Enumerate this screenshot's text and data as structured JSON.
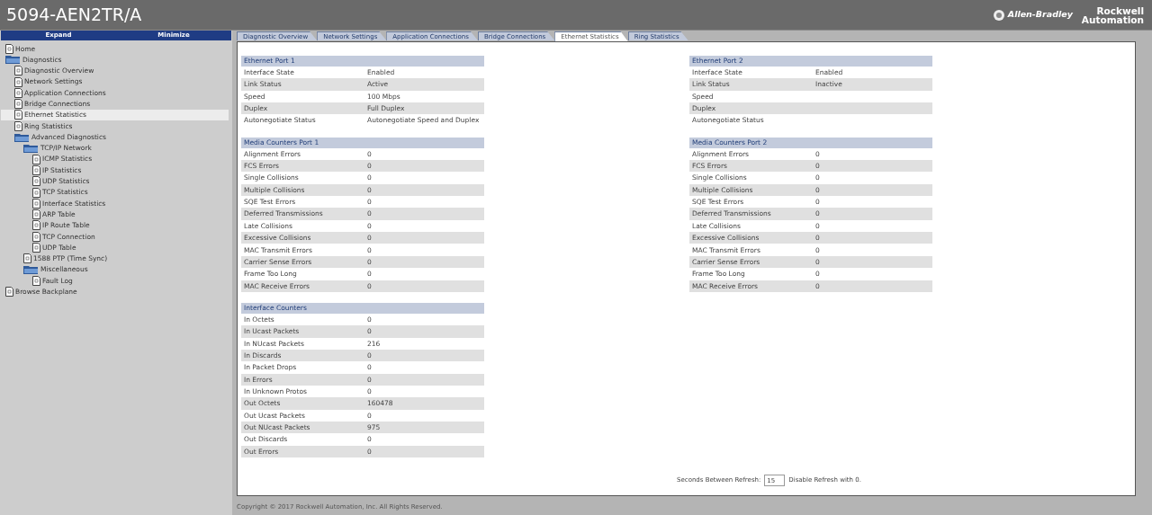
{
  "header": {
    "title": "5094-AEN2TR/A",
    "brand_1": "Allen-Bradley",
    "brand_2_line_1": "Rockwell",
    "brand_2_line_2": "Automation"
  },
  "sidebar": {
    "buttons": [
      "Expand",
      "Minimize"
    ],
    "items": [
      {
        "label": "Home",
        "kind": "page",
        "selected": false
      },
      {
        "label": "Diagnostics",
        "kind": "folder",
        "selected": false,
        "children": [
          {
            "label": "Diagnostic Overview",
            "kind": "page",
            "selected": false
          },
          {
            "label": "Network Settings",
            "kind": "page",
            "selected": false
          },
          {
            "label": "Application Connections",
            "kind": "page",
            "selected": false
          },
          {
            "label": "Bridge Connections",
            "kind": "page",
            "selected": false
          },
          {
            "label": "Ethernet Statistics",
            "kind": "page",
            "selected": true
          },
          {
            "label": "Ring Statistics",
            "kind": "page",
            "selected": false
          },
          {
            "label": "Advanced Diagnostics",
            "kind": "folder",
            "selected": false,
            "children": [
              {
                "label": "TCP/IP Network",
                "kind": "folder",
                "selected": false,
                "children": [
                  {
                    "label": "ICMP Statistics",
                    "kind": "page",
                    "selected": false
                  },
                  {
                    "label": "IP Statistics",
                    "kind": "page",
                    "selected": false
                  },
                  {
                    "label": "UDP Statistics",
                    "kind": "page",
                    "selected": false
                  },
                  {
                    "label": "TCP Statistics",
                    "kind": "page",
                    "selected": false
                  },
                  {
                    "label": "Interface Statistics",
                    "kind": "page",
                    "selected": false
                  },
                  {
                    "label": "ARP Table",
                    "kind": "page",
                    "selected": false
                  },
                  {
                    "label": "IP Route Table",
                    "kind": "page",
                    "selected": false
                  },
                  {
                    "label": "TCP Connection",
                    "kind": "page",
                    "selected": false
                  },
                  {
                    "label": "UDP Table",
                    "kind": "page",
                    "selected": false
                  }
                ]
              },
              {
                "label": "1588 PTP (Time Sync)",
                "kind": "page",
                "selected": false
              },
              {
                "label": "Miscellaneous",
                "kind": "folder",
                "selected": false,
                "children": [
                  {
                    "label": "Fault Log",
                    "kind": "page",
                    "selected": false
                  }
                ]
              }
            ]
          }
        ]
      },
      {
        "label": "Browse Backplane",
        "kind": "page",
        "selected": false
      }
    ]
  },
  "tabs": [
    {
      "label": "Diagnostic Overview",
      "selected": false
    },
    {
      "label": "Network Settings",
      "selected": false
    },
    {
      "label": "Application Connections",
      "selected": false
    },
    {
      "label": "Bridge Connections",
      "selected": false
    },
    {
      "label": "Ethernet Statistics",
      "selected": true
    },
    {
      "label": "Ring Statistics",
      "selected": false
    }
  ],
  "columns": [
    [
      {
        "title": "Ethernet Port 1",
        "rows": [
          [
            "Interface State",
            "Enabled"
          ],
          [
            "Link Status",
            "Active"
          ],
          [
            "Speed",
            "100 Mbps"
          ],
          [
            "Duplex",
            "Full Duplex"
          ],
          [
            "Autonegotiate Status",
            "Autonegotiate Speed and Duplex"
          ]
        ]
      },
      {
        "title": "Media Counters Port 1",
        "rows": [
          [
            "Alignment Errors",
            "0"
          ],
          [
            "FCS Errors",
            "0"
          ],
          [
            "Single Collisions",
            "0"
          ],
          [
            "Multiple Collisions",
            "0"
          ],
          [
            "SQE Test Errors",
            "0"
          ],
          [
            "Deferred Transmissions",
            "0"
          ],
          [
            "Late Collisions",
            "0"
          ],
          [
            "Excessive Collisions",
            "0"
          ],
          [
            "MAC Transmit Errors",
            "0"
          ],
          [
            "Carrier Sense Errors",
            "0"
          ],
          [
            "Frame Too Long",
            "0"
          ],
          [
            "MAC Receive Errors",
            "0"
          ]
        ]
      },
      {
        "title": "Interface Counters",
        "rows": [
          [
            "In Octets",
            "0"
          ],
          [
            "In Ucast Packets",
            "0"
          ],
          [
            "In NUcast Packets",
            "216"
          ],
          [
            "In Discards",
            "0"
          ],
          [
            "In Packet Drops",
            "0"
          ],
          [
            "In Errors",
            "0"
          ],
          [
            "In Unknown Protos",
            "0"
          ],
          [
            "Out Octets",
            "160478"
          ],
          [
            "Out Ucast Packets",
            "0"
          ],
          [
            "Out NUcast Packets",
            "975"
          ],
          [
            "Out Discards",
            "0"
          ],
          [
            "Out Errors",
            "0"
          ]
        ]
      }
    ],
    [
      {
        "title": "Ethernet Port 2",
        "rows": [
          [
            "Interface State",
            "Enabled"
          ],
          [
            "Link Status",
            "Inactive"
          ],
          [
            "Speed"
          ],
          [
            "Duplex"
          ],
          [
            "Autonegotiate Status"
          ]
        ]
      },
      {
        "title": "Media Counters Port 2",
        "rows": [
          [
            "Alignment Errors",
            "0"
          ],
          [
            "FCS Errors",
            "0"
          ],
          [
            "Single Collisions",
            "0"
          ],
          [
            "Multiple Collisions",
            "0"
          ],
          [
            "SQE Test Errors",
            "0"
          ],
          [
            "Deferred Transmissions",
            "0"
          ],
          [
            "Late Collisions",
            "0"
          ],
          [
            "Excessive Collisions",
            "0"
          ],
          [
            "MAC Transmit Errors",
            "0"
          ],
          [
            "Carrier Sense Errors",
            "0"
          ],
          [
            "Frame Too Long",
            "0"
          ],
          [
            "MAC Receive Errors",
            "0"
          ]
        ]
      }
    ]
  ],
  "refresh": {
    "label": "Seconds Between Refresh:",
    "value": "15",
    "note": "Disable Refresh with 0."
  },
  "footer": "Copyright © 2017 Rockwell Automation, Inc. All Rights Reserved."
}
